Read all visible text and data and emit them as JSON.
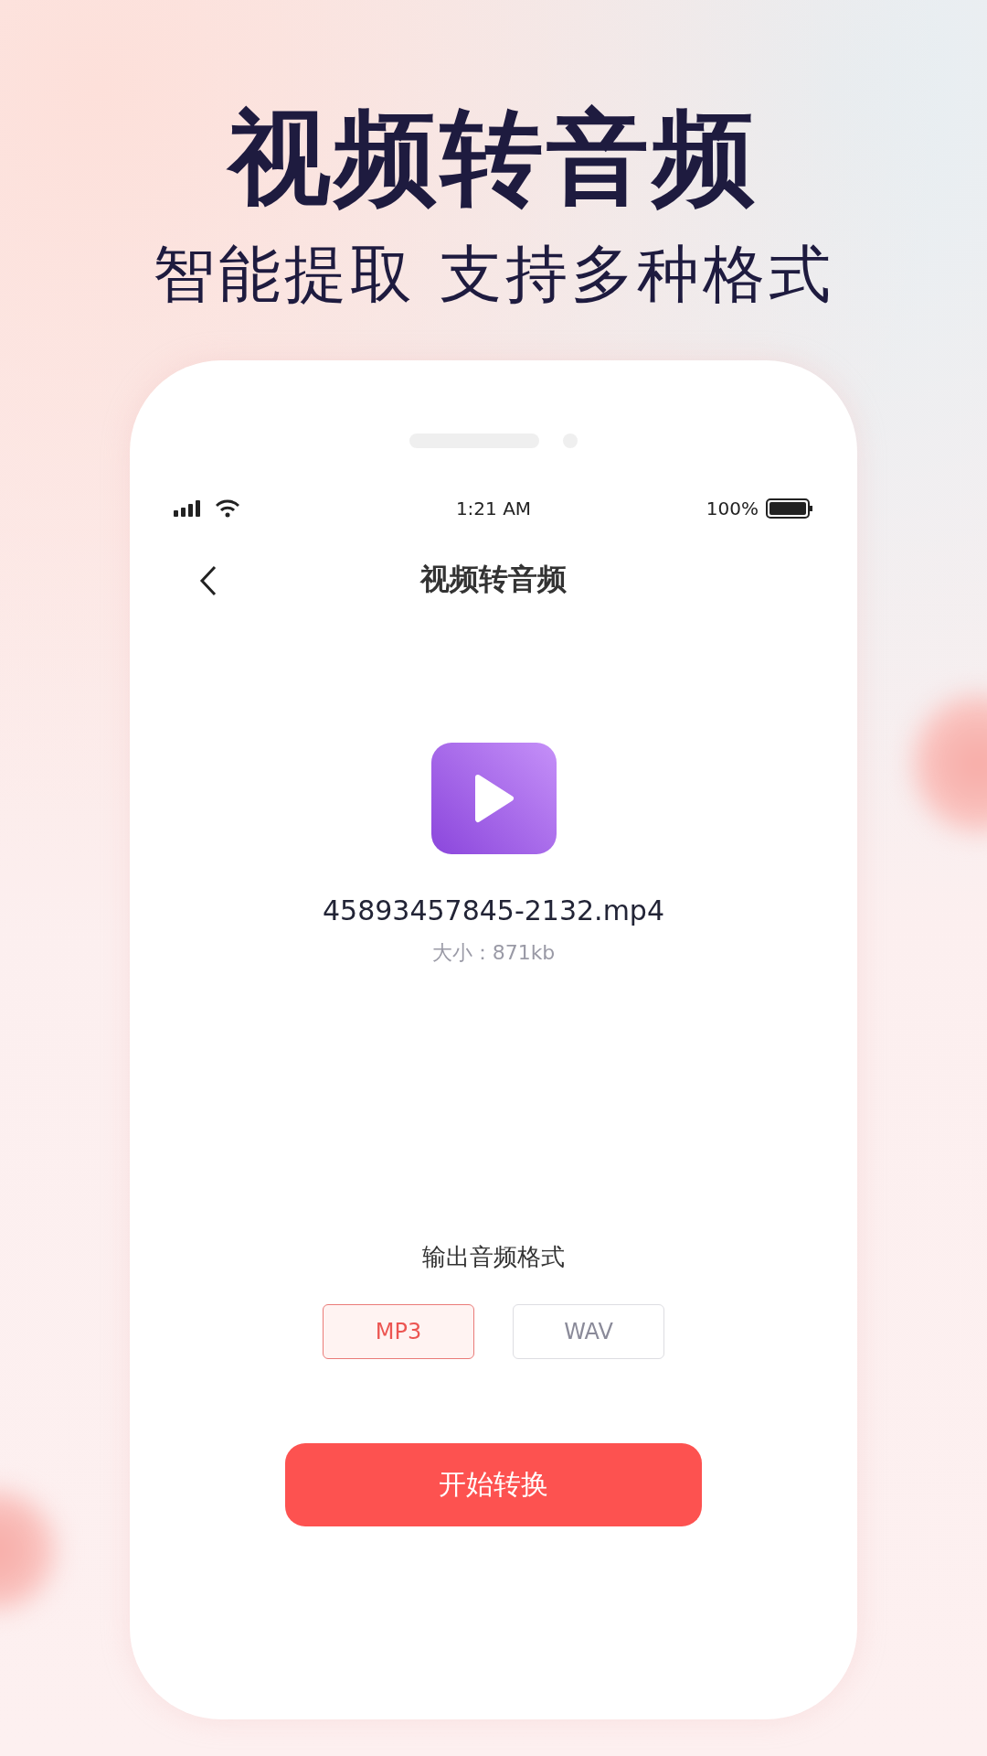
{
  "headline": "视频转音频",
  "subtitle": "智能提取 支持多种格式",
  "status_bar": {
    "time": "1:21 AM",
    "battery": "100%"
  },
  "nav": {
    "title": "视频转音频"
  },
  "file": {
    "name": "45893457845-2132.mp4",
    "size": "大小：871kb"
  },
  "output": {
    "label": "输出音频格式",
    "formats": [
      {
        "label": "MP3",
        "selected": true
      },
      {
        "label": "WAV",
        "selected": false
      }
    ]
  },
  "start_button": "开始转换"
}
